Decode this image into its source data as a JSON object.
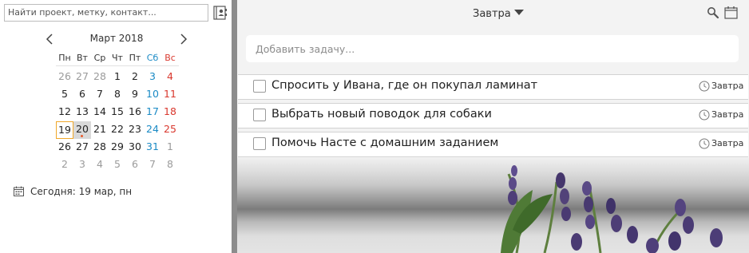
{
  "search": {
    "placeholder": "Найти проект, метку, контакт..."
  },
  "calendar": {
    "month_title": "Март 2018",
    "weekdays": [
      "Пн",
      "Вт",
      "Ср",
      "Чт",
      "Пт",
      "Сб",
      "Вс"
    ],
    "weeks": [
      [
        "26",
        "27",
        "28",
        "1",
        "2",
        "3",
        "4"
      ],
      [
        "5",
        "6",
        "7",
        "8",
        "9",
        "10",
        "11"
      ],
      [
        "12",
        "13",
        "14",
        "15",
        "16",
        "17",
        "18"
      ],
      [
        "19",
        "20",
        "21",
        "22",
        "23",
        "24",
        "25"
      ],
      [
        "26",
        "27",
        "28",
        "29",
        "30",
        "31",
        "1"
      ],
      [
        "2",
        "3",
        "4",
        "5",
        "6",
        "7",
        "8"
      ]
    ],
    "today_text": "Сегодня: 19 мар, пн"
  },
  "main": {
    "view_label": "Завтра",
    "add_task_placeholder": "Добавить задачу...",
    "tasks": [
      {
        "title": "Спросить у Ивана, где он покупал ламинат",
        "due": "Завтра"
      },
      {
        "title": "Выбрать новый поводок для собаки",
        "due": "Завтра"
      },
      {
        "title": "Помочь Насте с домашним заданием",
        "due": "Завтра"
      }
    ]
  },
  "colors": {
    "saturday": "#1a8ac5",
    "sunday": "#d9382e",
    "today_border": "#f0a82a",
    "selected_fill": "#d9d9d9",
    "divider": "#8c8c8c"
  },
  "icons": {
    "contacts": "contacts-book-icon",
    "prev": "chevron-left-icon",
    "next": "chevron-right-icon",
    "today": "calendar-icon",
    "dropdown": "caret-down-icon",
    "search": "search-icon",
    "calendar": "calendar-icon",
    "due": "clock-icon"
  }
}
